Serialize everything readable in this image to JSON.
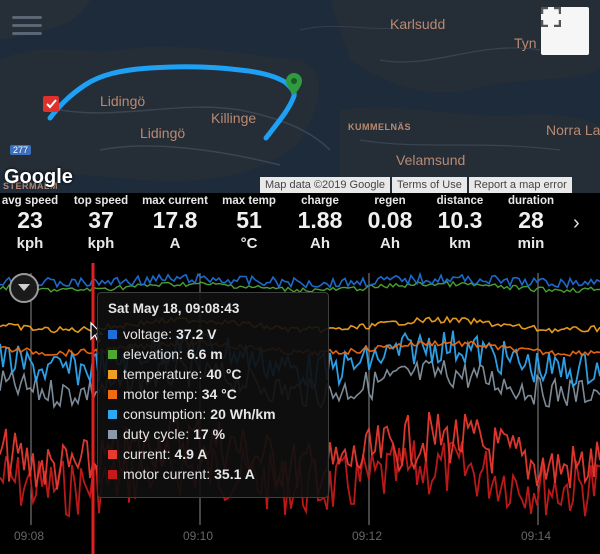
{
  "map": {
    "labels": {
      "karlsudd": "Karlsudd",
      "tyn": "Tyn",
      "lidingo1": "Lidingö",
      "lidingo2": "Lidingö",
      "killinge": "Killinge",
      "kummelnas": "KUMMELNÄS",
      "norra": "Norra La",
      "velamsund": "Velamsund",
      "stermalm": "STERMALM"
    },
    "road_number": "277",
    "google": "Google",
    "attribution": {
      "map_data": "Map data ©2019 Google",
      "terms": "Terms of Use",
      "report": "Report a map error"
    },
    "colors": {
      "route": "#1ea0f5",
      "water": "#1c2a3a",
      "land": "#222a33"
    }
  },
  "stats": [
    {
      "label": "avg speed",
      "value": "23",
      "unit": "kph"
    },
    {
      "label": "top speed",
      "value": "37",
      "unit": "kph"
    },
    {
      "label": "max current",
      "value": "17.8",
      "unit": "A"
    },
    {
      "label": "max temp",
      "value": "51",
      "unit": "°C"
    },
    {
      "label": "charge",
      "value": "1.88",
      "unit": "Ah"
    },
    {
      "label": "regen",
      "value": "0.08",
      "unit": "Ah"
    },
    {
      "label": "distance",
      "value": "10.3",
      "unit": "km"
    },
    {
      "label": "duration",
      "value": "28",
      "unit": "min"
    }
  ],
  "next_glyph": "›",
  "chart": {
    "time_labels": [
      "09:08",
      "09:10",
      "09:12",
      "09:14"
    ],
    "tooltip": {
      "title": "Sat May 18, 09:08:43",
      "rows": [
        {
          "name": "voltage:",
          "value": "37.2 V",
          "color": "#1f6fd6"
        },
        {
          "name": "elevation:",
          "value": "6.6 m",
          "color": "#4ea832"
        },
        {
          "name": "temperature:",
          "value": "40 °C",
          "color": "#f0a020"
        },
        {
          "name": "motor temp:",
          "value": "34 °C",
          "color": "#f06a10"
        },
        {
          "name": "consumption:",
          "value": "20 Wh/km",
          "color": "#2ea6f0"
        },
        {
          "name": "duty cycle:",
          "value": "17 %",
          "color": "#8b9aa8"
        },
        {
          "name": "current:",
          "value": "4.9 A",
          "color": "#e83a30"
        },
        {
          "name": "motor current:",
          "value": "35.1 A",
          "color": "#c41a1a"
        }
      ]
    }
  }
}
